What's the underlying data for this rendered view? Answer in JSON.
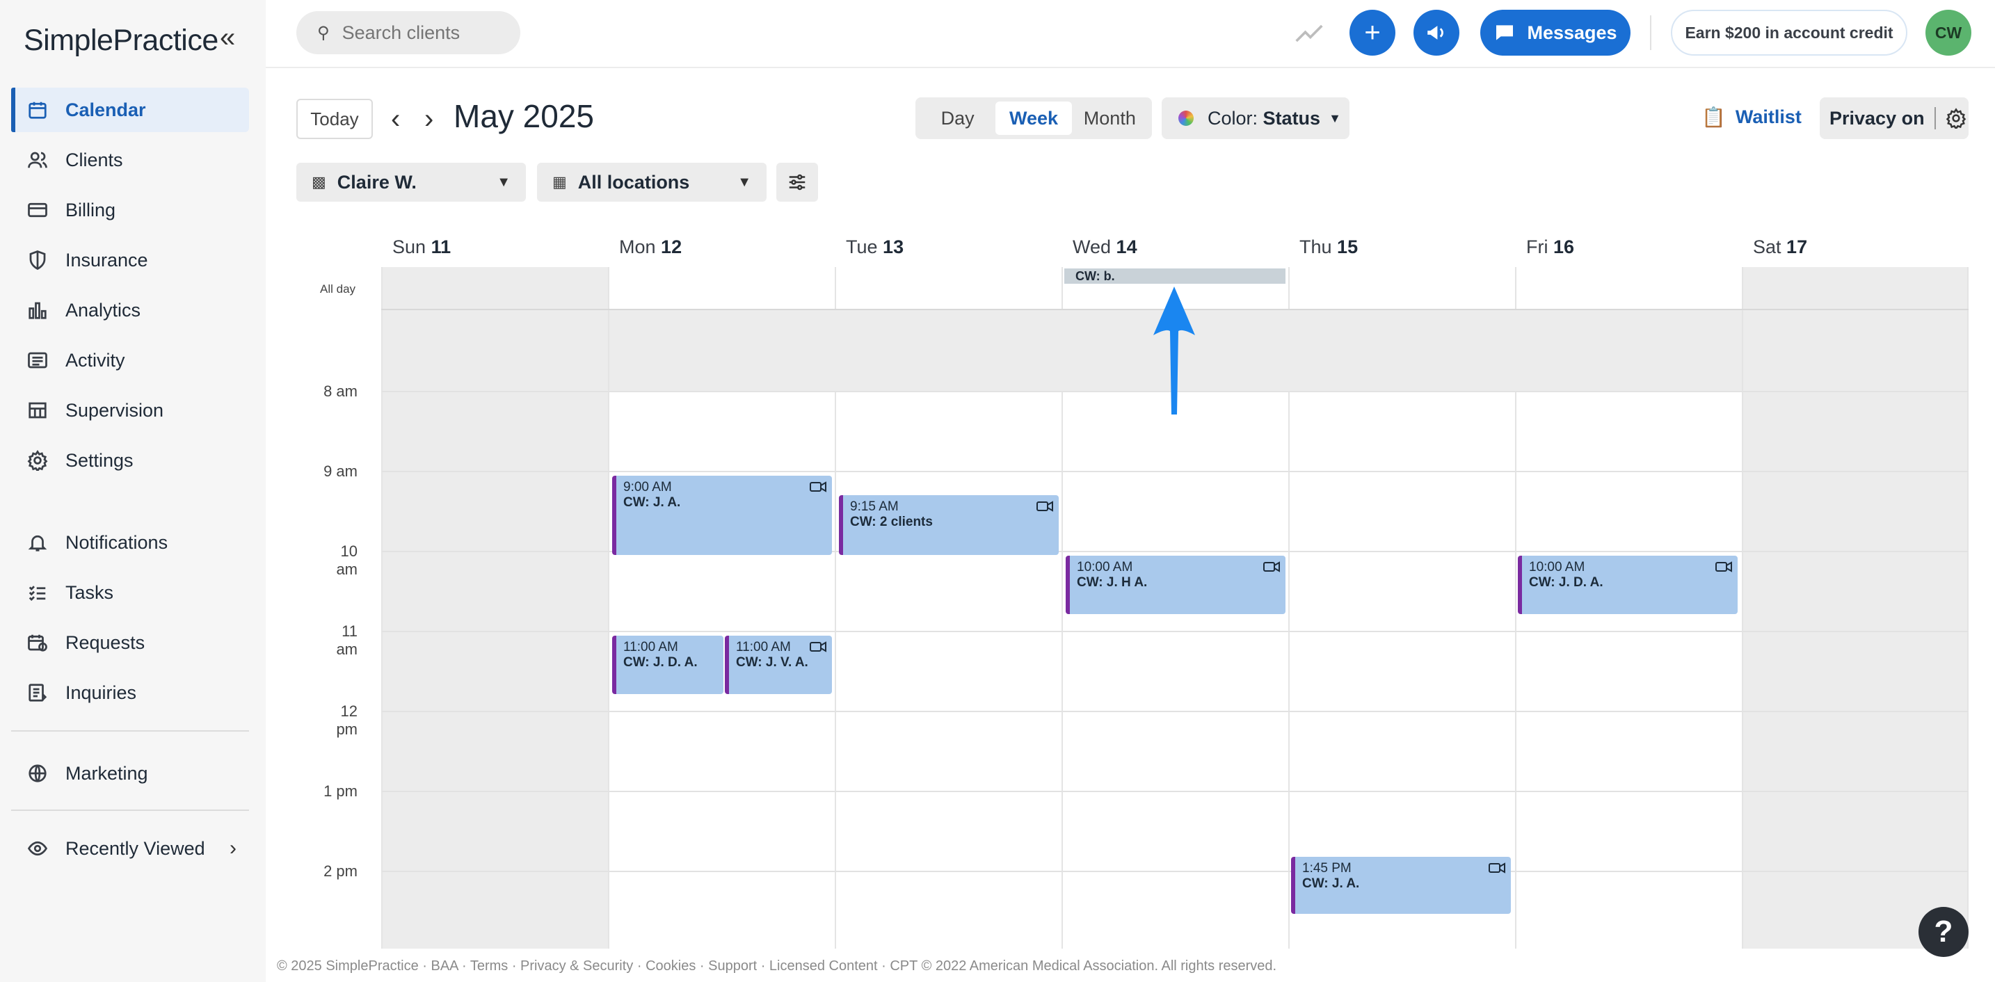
{
  "sidebar": {
    "logo": "SimplePractice",
    "collapse_icon": "«",
    "items": [
      {
        "label": "Calendar",
        "icon": "calendar-icon"
      },
      {
        "label": "Clients",
        "icon": "users-icon"
      },
      {
        "label": "Billing",
        "icon": "credit-card-icon"
      },
      {
        "label": "Insurance",
        "icon": "shield-icon"
      },
      {
        "label": "Analytics",
        "icon": "bar-chart-icon"
      },
      {
        "label": "Activity",
        "icon": "list-icon"
      },
      {
        "label": "Supervision",
        "icon": "grid-icon"
      },
      {
        "label": "Settings",
        "icon": "gear-icon"
      },
      {
        "label": "Notifications",
        "icon": "bell-icon"
      },
      {
        "label": "Tasks",
        "icon": "checklist-icon"
      },
      {
        "label": "Requests",
        "icon": "calendar-clock-icon"
      },
      {
        "label": "Inquiries",
        "icon": "document-list-icon"
      },
      {
        "label": "Marketing",
        "icon": "globe-icon"
      },
      {
        "label": "Recently Viewed",
        "icon": "eye-icon"
      }
    ]
  },
  "topbar": {
    "search_placeholder": "Search clients",
    "add_label": "+",
    "messages_label": "Messages",
    "earn_label": "Earn $200 in account credit",
    "avatar_initials": "CW"
  },
  "toolbar": {
    "today_label": "Today",
    "prev_label": "‹",
    "next_label": "›",
    "month_title": "May 2025",
    "views": [
      "Day",
      "Week",
      "Month"
    ],
    "active_view": "Week",
    "color_label": "Color:",
    "color_value": "Status",
    "waitlist_label": "Waitlist",
    "privacy_label": "Privacy on",
    "clinician_filter": "Claire W.",
    "location_filter": "All locations"
  },
  "calendar": {
    "days": [
      {
        "name": "Sun",
        "num": "11"
      },
      {
        "name": "Mon",
        "num": "12"
      },
      {
        "name": "Tue",
        "num": "13"
      },
      {
        "name": "Wed",
        "num": "14"
      },
      {
        "name": "Thu",
        "num": "15"
      },
      {
        "name": "Fri",
        "num": "16"
      },
      {
        "name": "Sat",
        "num": "17"
      }
    ],
    "allday_label": "All day",
    "allday_event": "CW: b.",
    "hours": [
      "8 am",
      "9 am",
      "10 am",
      "11 am",
      "12 pm",
      "1 pm",
      "2 pm"
    ],
    "events": [
      {
        "time": "9:00 AM",
        "name": "CW: J. A.",
        "day": "Mon 12"
      },
      {
        "time": "9:15 AM",
        "name": "CW: 2 clients",
        "day": "Tue 13"
      },
      {
        "time": "10:00 AM",
        "name": "CW: J. H A.",
        "day": "Wed 14"
      },
      {
        "time": "10:00 AM",
        "name": "CW: J. D. A.",
        "day": "Fri 16"
      },
      {
        "time": "11:00 AM",
        "name": "CW: J. D. A.",
        "day": "Mon 12"
      },
      {
        "time": "11:00 AM",
        "name": "CW: J. V. A.",
        "day": "Mon 12"
      },
      {
        "time": "1:45 PM",
        "name": "CW: J. A.",
        "day": "Thu 15"
      }
    ],
    "event_color": "#a9c9ec",
    "event_accent": "#7a2aa0"
  },
  "footer": {
    "text": "© 2025 SimplePractice · BAA · Terms · Privacy & Security · Cookies · Support · Licensed Content · CPT © 2022 American Medical Association. All rights reserved."
  },
  "help_label": "?"
}
